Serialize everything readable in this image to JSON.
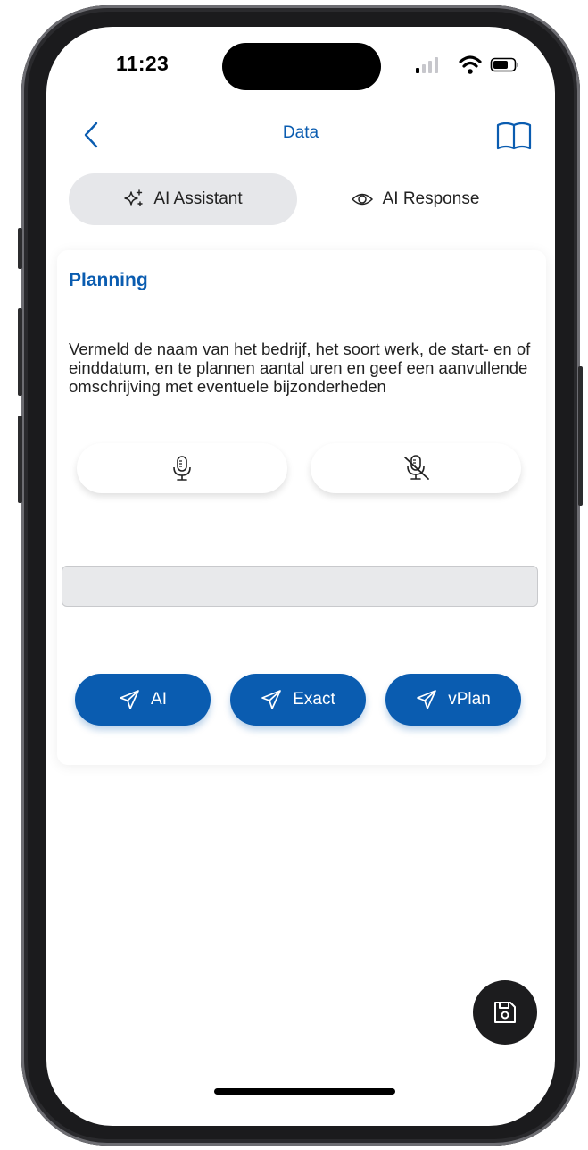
{
  "status_bar": {
    "time": "11:23"
  },
  "header": {
    "title": "Data",
    "back_icon": "chevron-left-icon",
    "book_icon": "book-open-icon"
  },
  "tabs": [
    {
      "label": "AI Assistant",
      "icon": "sparkles-icon",
      "active": true
    },
    {
      "label": "AI Response",
      "icon": "eye-icon",
      "active": false
    }
  ],
  "card": {
    "title": "Planning",
    "description": "Vermeld de naam van het bedrijf, het soort werk, de start- en of einddatum, en te plannen aantal uren en geef een aanvullende omschrijving met eventuele bijzonderheden",
    "mic_icons": [
      "microphone-icon",
      "microphone-off-icon"
    ],
    "input": {
      "value": "",
      "placeholder": ""
    },
    "actions": [
      {
        "label": "AI",
        "icon": "send-icon"
      },
      {
        "label": "Exact",
        "icon": "send-icon"
      },
      {
        "label": "vPlan",
        "icon": "send-icon"
      }
    ]
  },
  "fab": {
    "icon": "save-icon"
  },
  "colors": {
    "accent": "#0a5cb0",
    "tab_active_bg": "#e6e7ea",
    "fab_bg": "#1c1c1e"
  }
}
